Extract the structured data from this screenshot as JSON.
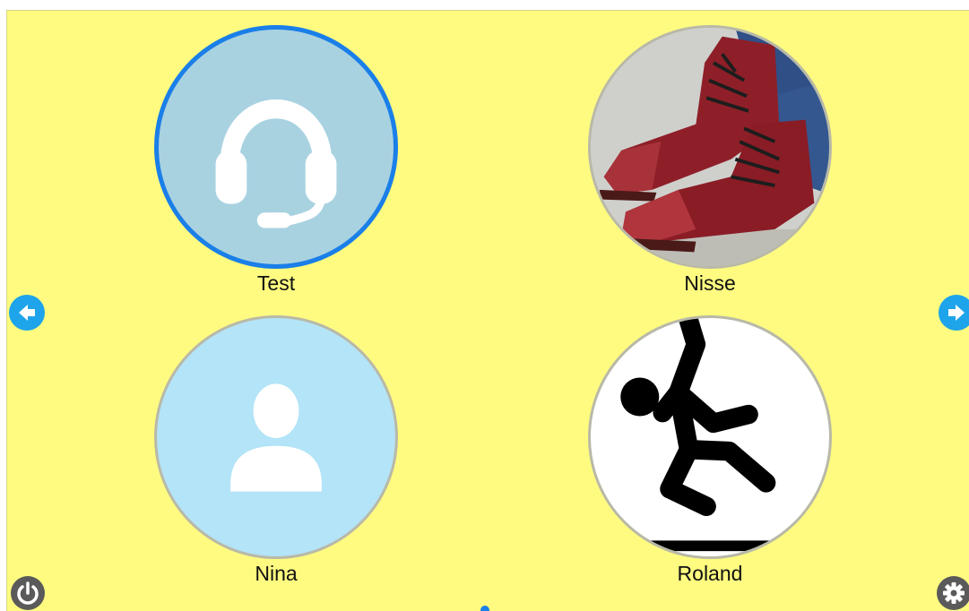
{
  "colors": {
    "background": "#fefb80",
    "accent": "#1a7fe8",
    "nav_button": "#1ea4ea",
    "corner_button": "#5a5a5a",
    "avatar_border": "#b9b9a8",
    "headset_bg": "#a9d2e1",
    "person_bg": "#b3e4f7"
  },
  "contacts": [
    {
      "name": "Test",
      "avatar": "headset-icon",
      "selected": true
    },
    {
      "name": "Nisse",
      "avatar": "red-boots-photo",
      "selected": false
    },
    {
      "name": "Nina",
      "avatar": "person-icon",
      "selected": false
    },
    {
      "name": "Roland",
      "avatar": "falling-man-icon",
      "selected": false
    }
  ],
  "navigation": {
    "previous_icon": "arrow-left-icon",
    "next_icon": "arrow-right-icon"
  },
  "corner_buttons": {
    "power_icon": "power-icon",
    "settings_icon": "gear-icon"
  }
}
